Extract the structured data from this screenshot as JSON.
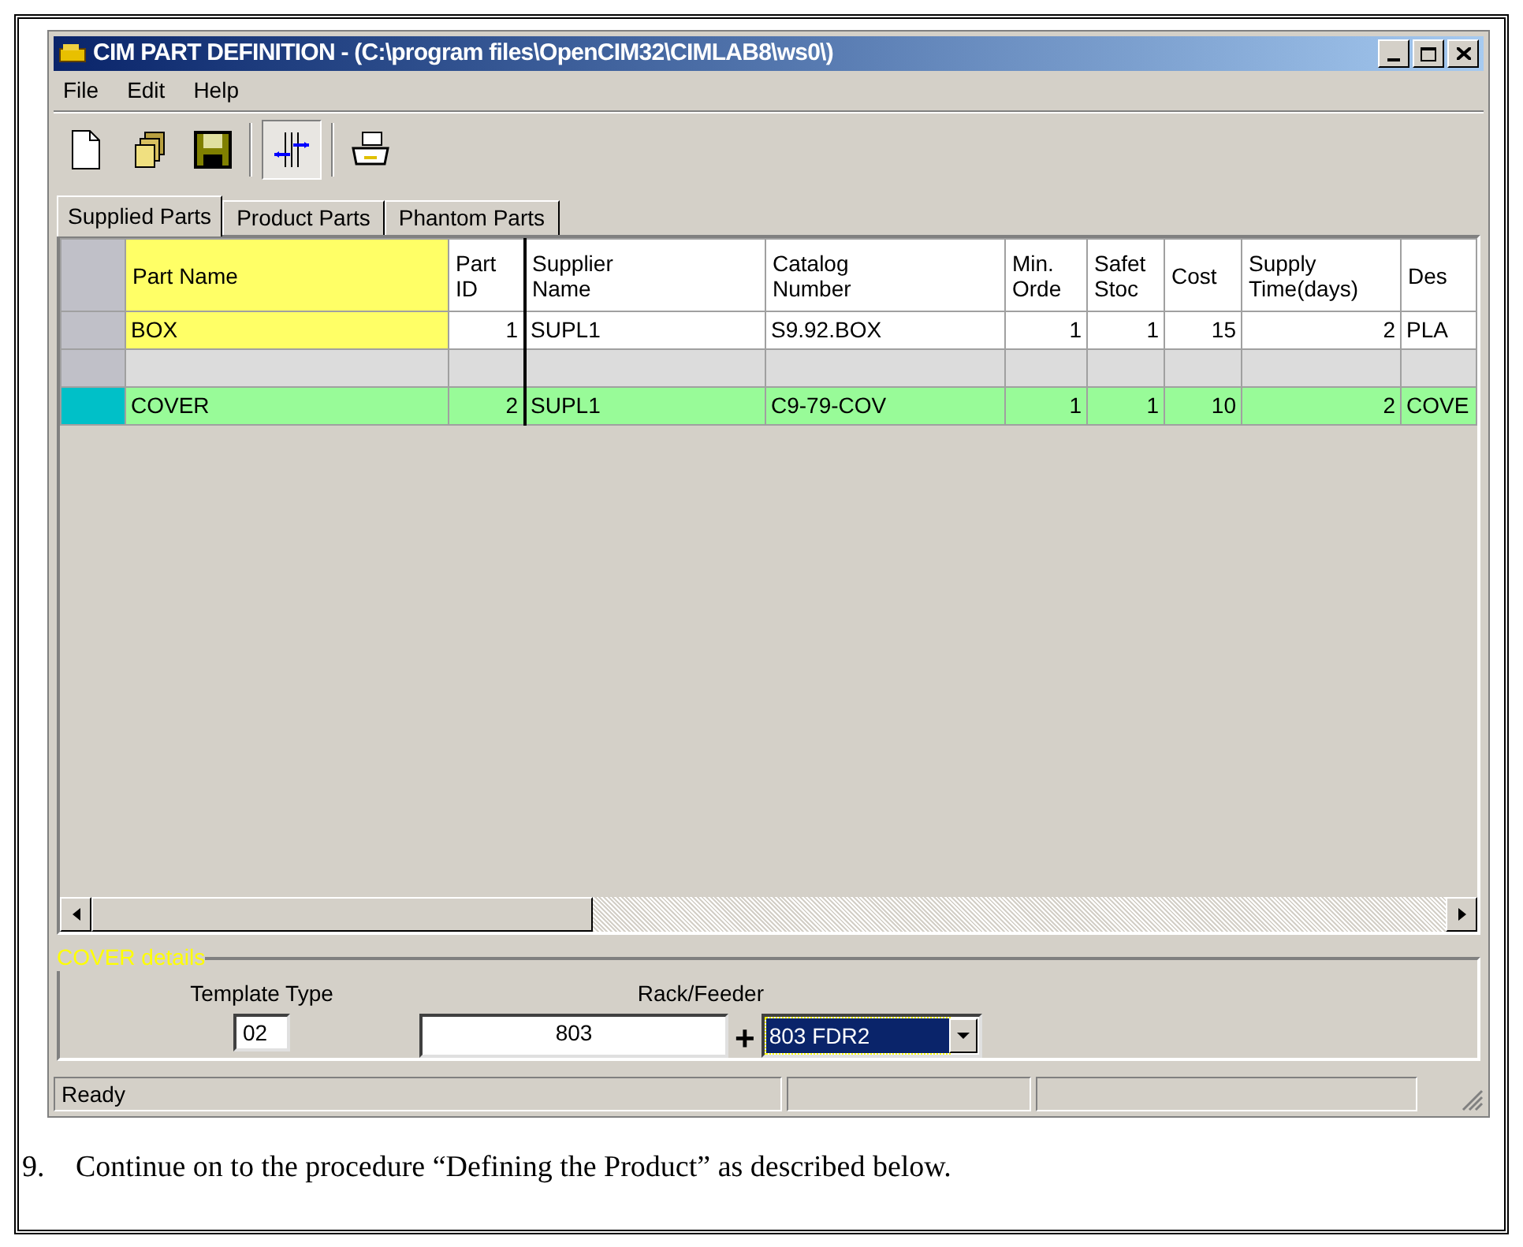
{
  "window": {
    "title": "CIM PART DEFINITION - (C:\\program files\\OpenCIM32\\CIMLAB8\\ws0\\)"
  },
  "menu": [
    "File",
    "Edit",
    "Help"
  ],
  "toolbar": [
    {
      "kind": "new",
      "pressed": false
    },
    {
      "kind": "copy",
      "pressed": false
    },
    {
      "kind": "save",
      "pressed": false
    },
    {
      "kind": "align",
      "pressed": true
    },
    {
      "kind": "print",
      "pressed": false
    }
  ],
  "tabs": [
    {
      "label": "Supplied Parts",
      "selected": true
    },
    {
      "label": "Product Parts",
      "selected": false
    },
    {
      "label": "Phantom Parts",
      "selected": false
    }
  ],
  "table": {
    "columns": [
      {
        "lines": [
          "Part Name"
        ],
        "kind": "text"
      },
      {
        "lines": [
          "Part",
          "ID"
        ],
        "kind": "number"
      },
      {
        "lines": [
          "Supplier",
          "Name"
        ],
        "kind": "text"
      },
      {
        "lines": [
          "Catalog",
          "Number"
        ],
        "kind": "text"
      },
      {
        "lines": [
          "Min.",
          "Orde"
        ],
        "kind": "number"
      },
      {
        "lines": [
          "Safet",
          "Stoc"
        ],
        "kind": "number"
      },
      {
        "lines": [
          "Cost"
        ],
        "kind": "number"
      },
      {
        "lines": [
          "Supply",
          "Time(days)"
        ],
        "kind": "number"
      },
      {
        "lines": [
          "Des"
        ],
        "kind": "text"
      }
    ],
    "rows": [
      {
        "selected": false,
        "color": "#ffffff",
        "name": {
          "text": "BOX",
          "color": "#ffff66"
        },
        "cells": [
          "1",
          "SUPL1",
          "S9.92.BOX",
          "1",
          "1",
          "15",
          "2",
          "PLA"
        ]
      },
      {
        "selected": false,
        "color": "#dcdcdc",
        "name": {
          "color": "#dcdcdc"
        }
      },
      {
        "selected": true,
        "color": "#98fb98",
        "name": {
          "text": "COVER",
          "color": "#98fb98"
        },
        "cells": [
          "2",
          "SUPL1",
          "C9-79-COV",
          "1",
          "1",
          "10",
          "2",
          "COVE"
        ]
      }
    ]
  },
  "details": {
    "title": "COVER details",
    "template_label": "Template Type",
    "template_value": "02",
    "rack_label": "Rack/Feeder",
    "rack_value": "803",
    "plus": "+",
    "feeder_value": "803 FDR2"
  },
  "status_bar": {
    "text": "Ready"
  },
  "caption": {
    "number": "9.",
    "text": "Continue on to the procedure “Defining the Product” as described below."
  }
}
